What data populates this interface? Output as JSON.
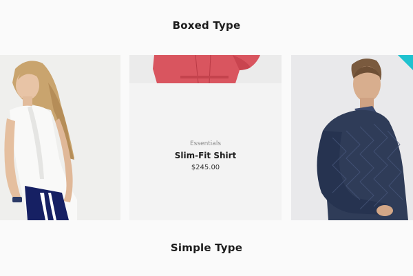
{
  "sections": {
    "boxed_title": "Boxed Type",
    "simple_title": "Simple Type"
  },
  "products": [
    {
      "image": "woman-white-top-photo"
    },
    {
      "image": "red-shirt-photo",
      "category": "Essentials",
      "name": "Slim-Fit Shirt",
      "price": "$245.00"
    },
    {
      "image": "man-navy-sweater-photo",
      "badge_color": "#1fc2cf"
    }
  ]
}
